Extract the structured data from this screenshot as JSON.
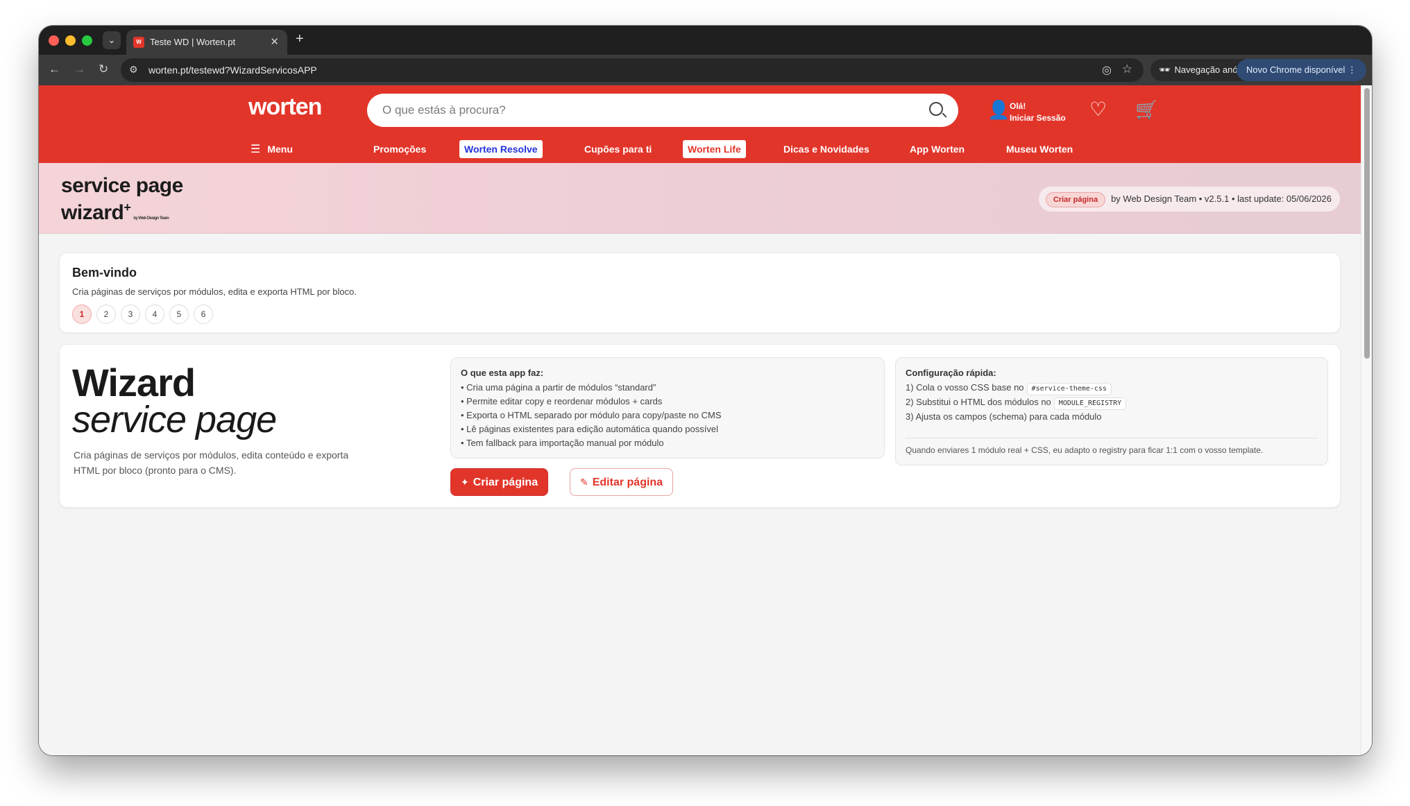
{
  "browser": {
    "tab_title": "Teste WD | Worten.pt",
    "tab_favicon": "W",
    "url": "worten.pt/testewd?WizardServicosAPP",
    "incognito_label": "Navegação anónima",
    "update_label": "Novo Chrome disponível"
  },
  "header": {
    "logo": "worten",
    "search_placeholder": "O que estás à procura?",
    "account_greeting": "Olá!",
    "account_login": "Iniciar Sessão",
    "nav": [
      "Menu",
      "Promoções",
      "Worten Resolve",
      "Cupões para ti",
      "Worten Life",
      "Dicas e Novidades",
      "App Worten",
      "Museu Worten"
    ]
  },
  "banner": {
    "logo_line1": "service page",
    "logo_line2": "wizard",
    "logo_plus": "+",
    "logo_by": "by Web Design Team",
    "badge": "Criar página",
    "meta": "by Web Design Team • v2.5.1 • last update: 05/06/2026"
  },
  "welcome": {
    "title": "Bem-vindo",
    "subtitle": "Cria páginas de serviços por módulos, edita e exporta HTML por bloco.",
    "steps": [
      "1",
      "2",
      "3",
      "4",
      "5",
      "6"
    ],
    "active_step": 1
  },
  "hero": {
    "title": "Wizard",
    "subtitle": "service page",
    "description": "Cria páginas de serviços por módulos, edita conteúdo e exporta HTML por bloco (pronto para o CMS).",
    "info_title": "O que esta app faz:",
    "info_items": [
      "Cria uma página a partir de módulos “standard”",
      "Permite editar copy e reordenar módulos + cards",
      "Exporta o HTML separado por módulo para copy/paste no CMS",
      "Lê páginas existentes para edição automática quando possível",
      "Tem fallback para importação manual por módulo"
    ],
    "config_title": "Configuração rápida:",
    "config_1": "1) Cola o vosso CSS base no",
    "config_1_code": "#service-theme-css",
    "config_2": "2) Substitui o HTML dos módulos no",
    "config_2_code": "MODULE_REGISTRY",
    "config_3": "3) Ajusta os campos (schema) para cada módulo",
    "config_note": "Quando enviares 1 módulo real + CSS, eu adapto o registry para ficar 1:1 com o vosso template.",
    "btn_create": "Criar página",
    "btn_edit": "Editar página"
  }
}
